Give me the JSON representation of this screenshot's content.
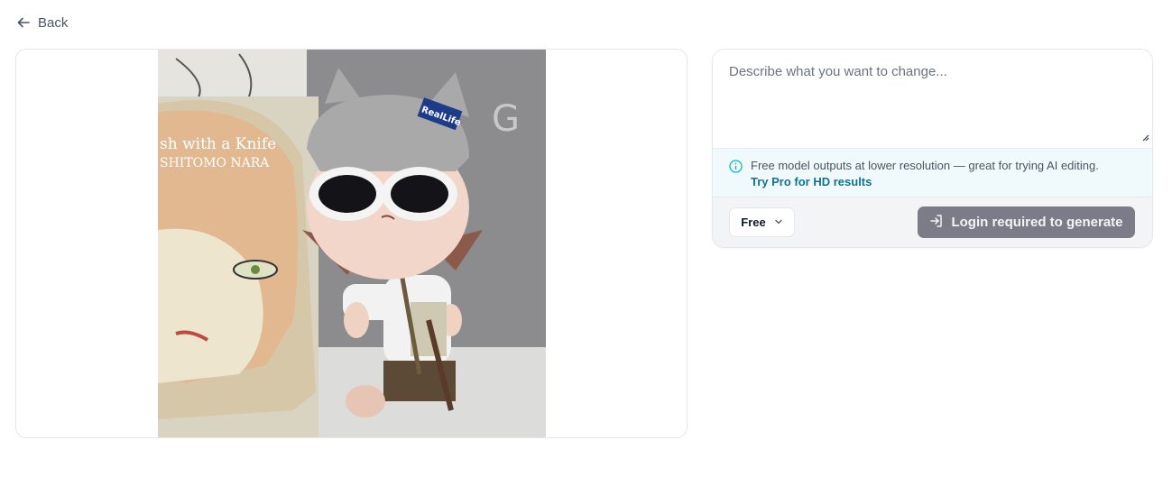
{
  "nav": {
    "back_label": "Back"
  },
  "image": {
    "alt": "Uploaded photo of a toy figure with sunglasses and a beanie",
    "hat_tag": "RealLife",
    "book_title_line1": "sh with a Knife",
    "book_title_line2": "SHITOMO NARA"
  },
  "editor": {
    "prompt_placeholder": "Describe what you want to change...",
    "notice_text": "Free model outputs at lower resolution — great for trying AI editing.",
    "notice_link": "Try Pro for HD results",
    "model_select_value": "Free",
    "generate_label": "Login required to generate"
  },
  "colors": {
    "accent_link": "#0e7490",
    "button_disabled": "#7c7c88",
    "info_icon": "#06b6d4"
  }
}
